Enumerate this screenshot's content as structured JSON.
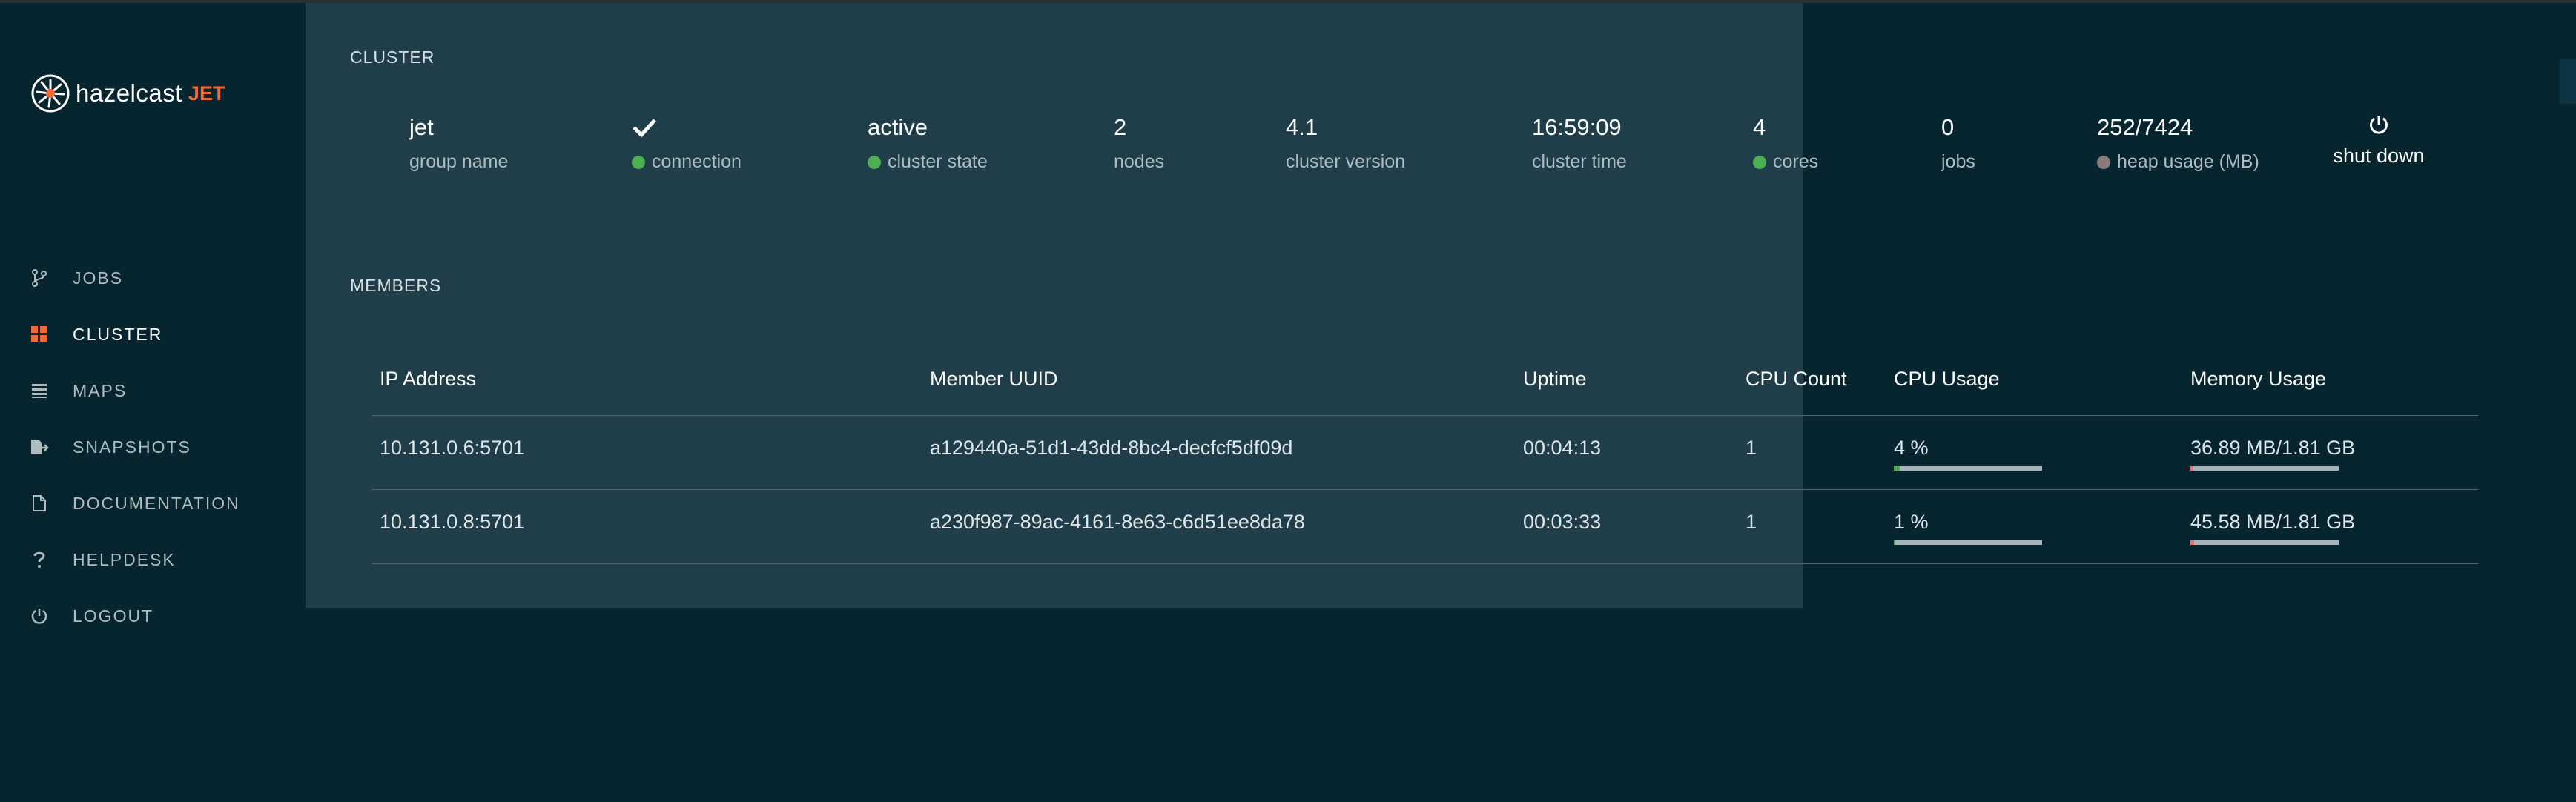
{
  "brand": {
    "name": "hazelcast",
    "accent": "JET",
    "accent_color": "#ef6b3a"
  },
  "sidebar": {
    "items": [
      {
        "label": "JOBS",
        "icon": "branch-icon",
        "active": false
      },
      {
        "label": "CLUSTER",
        "icon": "grid-icon",
        "active": true
      },
      {
        "label": "MAPS",
        "icon": "list-icon",
        "active": false
      },
      {
        "label": "SNAPSHOTS",
        "icon": "snapshot-export-icon",
        "active": false
      },
      {
        "label": "DOCUMENTATION",
        "icon": "document-icon",
        "active": false
      },
      {
        "label": "HELPDESK",
        "icon": "question-icon",
        "active": false
      },
      {
        "label": "LOGOUT",
        "icon": "power-icon",
        "active": false
      }
    ]
  },
  "cluster": {
    "title": "CLUSTER",
    "group_name": {
      "value": "jet",
      "label": "group name"
    },
    "connection": {
      "label": "connection",
      "icon": "checkmark-icon",
      "status_color": "#4caf50"
    },
    "cluster_state": {
      "value": "active",
      "label": "cluster state",
      "status_color": "#4caf50"
    },
    "nodes": {
      "value": "2",
      "label": "nodes"
    },
    "cluster_version": {
      "value": "4.1",
      "label": "cluster version"
    },
    "cluster_time": {
      "value": "16:59:09",
      "label": "cluster time"
    },
    "cores": {
      "value": "4",
      "label": "cores",
      "status_color": "#4caf50"
    },
    "jobs": {
      "value": "0",
      "label": "jobs"
    },
    "heap_usage": {
      "value": "252/7424",
      "label": "heap usage (MB)",
      "status_color": "#8a7a7a"
    },
    "shutdown": {
      "label": "shut down",
      "icon": "power-icon"
    }
  },
  "members": {
    "title": "MEMBERS",
    "columns": [
      "IP Address",
      "Member UUID",
      "Uptime",
      "CPU Count",
      "CPU Usage",
      "Memory Usage"
    ],
    "rows": [
      {
        "ip": "10.131.0.6:5701",
        "uuid": "a129440a-51d1-43dd-8bc4-decfcf5df09d",
        "uptime": "00:04:13",
        "cpu_count": "1",
        "cpu_usage": "4 %",
        "cpu_fraction": 0.04,
        "memory_usage": "36.89 MB/1.81 GB",
        "memory_fraction": 0.02
      },
      {
        "ip": "10.131.0.8:5701",
        "uuid": "a230f987-89ac-4161-8e63-c6d51ee8da78",
        "uptime": "00:03:33",
        "cpu_count": "1",
        "cpu_usage": "1 %",
        "cpu_fraction": 0.01,
        "memory_usage": "45.58 MB/1.81 GB",
        "memory_fraction": 0.025
      }
    ]
  },
  "colors": {
    "bar_fill_cpu": "#4caf50",
    "bar_fill_mem": "#e57373",
    "bar_track": "#a6b4b9"
  }
}
